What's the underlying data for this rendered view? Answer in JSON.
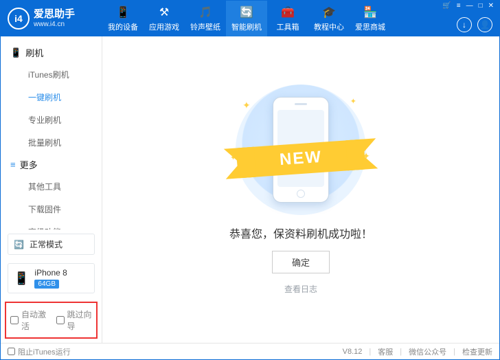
{
  "brand": {
    "logo_text": "i4",
    "name": "爱思助手",
    "url": "www.i4.cn"
  },
  "nav": {
    "items": [
      {
        "label": "我的设备",
        "icon": "📱"
      },
      {
        "label": "应用游戏",
        "icon": "⚒"
      },
      {
        "label": "铃声壁纸",
        "icon": "🎵"
      },
      {
        "label": "智能刷机",
        "icon": "🔄"
      },
      {
        "label": "工具箱",
        "icon": "🧰"
      },
      {
        "label": "教程中心",
        "icon": "🎓"
      },
      {
        "label": "爱思商城",
        "icon": "🏪"
      }
    ],
    "active_index": 3
  },
  "window_controls": {
    "min": "—",
    "max": "□",
    "close": "✕",
    "menu": "≡",
    "cart": "🛒"
  },
  "header_buttons": {
    "download": "↓",
    "user": "👤"
  },
  "sidebar": {
    "section1": {
      "title": "刷机",
      "icon": "📱",
      "items": [
        "iTunes刷机",
        "一键刷机",
        "专业刷机",
        "批量刷机"
      ],
      "active_index": 1
    },
    "section2": {
      "title": "更多",
      "icon": "≡",
      "items": [
        "其他工具",
        "下载固件",
        "高级功能"
      ]
    },
    "status": {
      "icon": "🔄",
      "label": "正常模式"
    },
    "device": {
      "icon": "📱",
      "name": "iPhone 8",
      "storage": "64GB"
    },
    "bottom_checks": {
      "auto_activate": "自动激活",
      "skip_guide": "跳过向导"
    }
  },
  "main": {
    "ribbon_text": "NEW",
    "message": "恭喜您，保资料刷机成功啦！",
    "confirm": "确定",
    "log_link": "查看日志"
  },
  "footer": {
    "block_itunes": "阻止iTunes运行",
    "version": "V8.12",
    "support": "客服",
    "wechat": "微信公众号",
    "update": "检查更新"
  }
}
